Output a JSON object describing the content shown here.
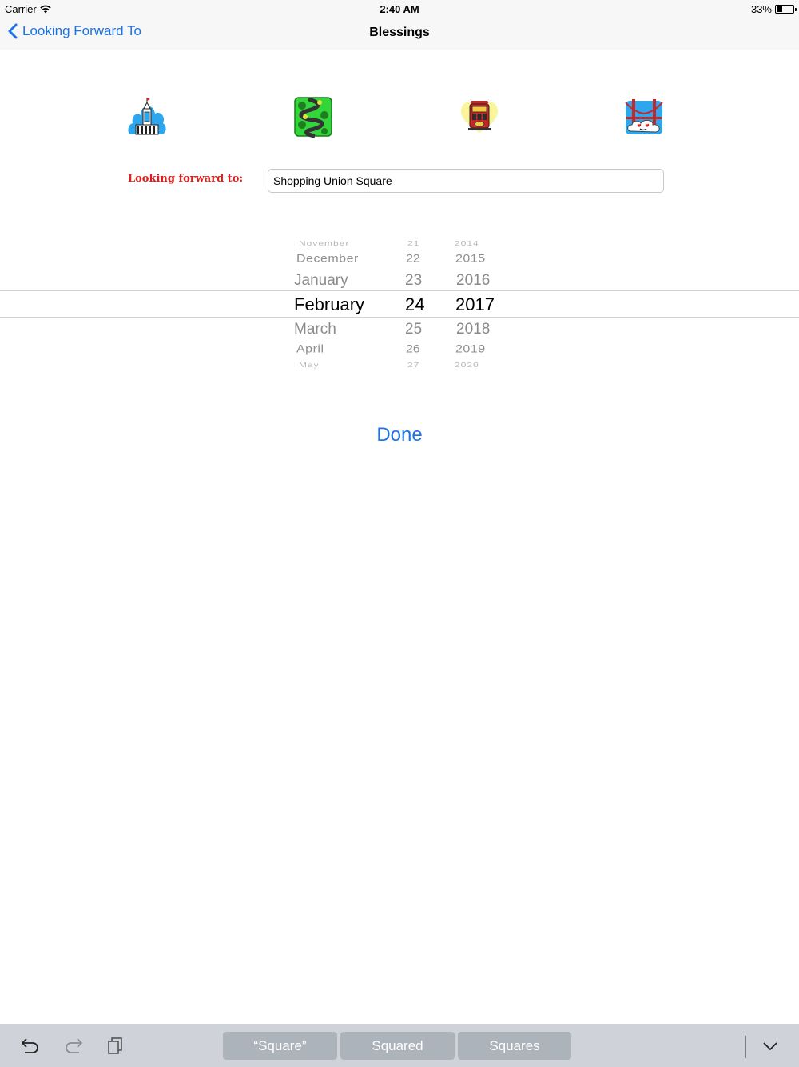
{
  "status_bar": {
    "carrier": "Carrier",
    "time": "2:40 AM",
    "battery_percent": "33%",
    "battery_level": 0.33
  },
  "nav": {
    "back_label": "Looking Forward To",
    "title": "Blessings"
  },
  "icons": [
    "city-hall-icon",
    "lombard-street-icon",
    "cable-car-icon",
    "golden-gate-bridge-icon"
  ],
  "form": {
    "label": "Looking forward to:",
    "value": "Shopping Union Square"
  },
  "picker": {
    "months": [
      "November",
      "December",
      "January",
      "February",
      "March",
      "April",
      "May"
    ],
    "days": [
      "21",
      "22",
      "23",
      "24",
      "25",
      "26",
      "27"
    ],
    "years": [
      "2014",
      "2015",
      "2016",
      "2017",
      "2018",
      "2019",
      "2020"
    ],
    "selected": {
      "month": "February",
      "day": "24",
      "year": "2017"
    }
  },
  "done_label": "Done",
  "shortcut_bar": {
    "suggestions": [
      "“Square”",
      "Squared",
      "Squares"
    ],
    "icons": [
      "undo-icon",
      "redo-icon",
      "paste-icon",
      "dismiss-keyboard-icon"
    ]
  },
  "colors": {
    "accent": "#1a73e8",
    "label_red": "#e21b1b"
  }
}
